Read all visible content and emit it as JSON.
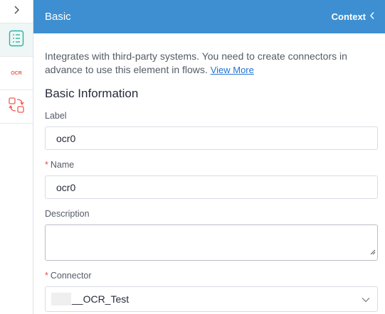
{
  "rail": {
    "toggle_icon": "chevron-right-icon",
    "tabs": [
      {
        "name": "properties",
        "icon": "list-document-icon",
        "active": true
      },
      {
        "name": "ocr",
        "label": "OCR",
        "active": false
      },
      {
        "name": "mapping",
        "icon": "swap-icon",
        "active": false
      }
    ]
  },
  "header": {
    "title": "Basic",
    "context_label": "Context"
  },
  "description": {
    "text": "Integrates with third-party systems. You need to create connectors in advance to use this element in flows.",
    "link": "View More"
  },
  "section_title": "Basic Information",
  "fields": {
    "label": {
      "label": "Label",
      "value": "ocr0"
    },
    "name": {
      "label": "Name",
      "required_mark": "*",
      "value": "ocr0"
    },
    "description": {
      "label": "Description",
      "value": ""
    },
    "connector": {
      "label": "Connector",
      "required_mark": "*",
      "value": "__OCR_Test"
    }
  },
  "colors": {
    "header_bg": "#3d8fd1",
    "accent_teal": "#2bb3a5",
    "ocr_red": "#f25c54",
    "link": "#1f73d4",
    "required": "#e6504a"
  }
}
